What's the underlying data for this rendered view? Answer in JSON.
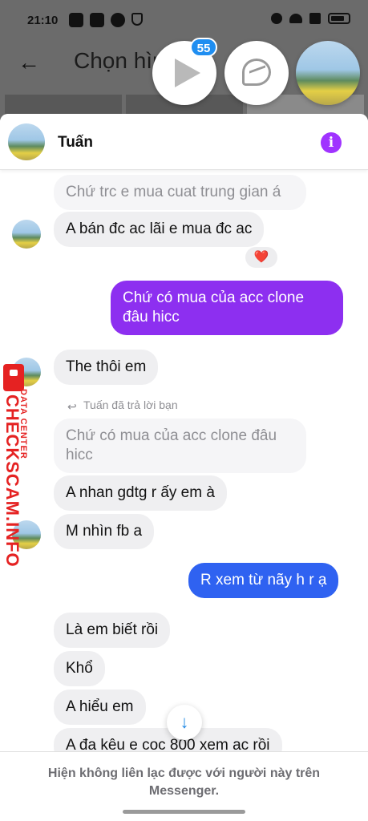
{
  "status_bar": {
    "time": "21:10"
  },
  "background_app": {
    "title_partial": "Chọn hìn"
  },
  "chat_heads": {
    "unread_badge": "55"
  },
  "header": {
    "contact_name": "Tuấn"
  },
  "messages": [
    {
      "text": "Chứ trc e mua cuat trung gian á"
    },
    {
      "text": "A bán đc ac lãi e mua đc ac"
    },
    {
      "text": "Chứ có mua của acc clone đâu hicc"
    },
    {
      "text": "The thôi em"
    },
    {
      "text": "Chứ có mua của acc clone đâu hicc"
    },
    {
      "text": "A nhan gdtg r ấy em à"
    },
    {
      "text": "M nhìn fb a"
    },
    {
      "text": "R xem từ nãy h r ạ"
    },
    {
      "text": "Là em biết rồi"
    },
    {
      "text": "Khổ"
    },
    {
      "text": "A hiểu em"
    },
    {
      "text": "A đa kêu e coc 800 xem ac rồi"
    }
  ],
  "reaction": "❤️",
  "reply_note": "Tuấn đã trả lời bạn",
  "footer": {
    "notice": "Hiện không liên lạc được với người này trên Messenger."
  },
  "watermark": {
    "brand": "CHECKSCAM.INFO",
    "sub": "DATA CENTER"
  },
  "colors": {
    "outgoing_purple": "#8d2ff0",
    "outgoing_blue": "#2f62f1",
    "info_icon": "#a033ff",
    "badge": "#1f8ef1"
  }
}
